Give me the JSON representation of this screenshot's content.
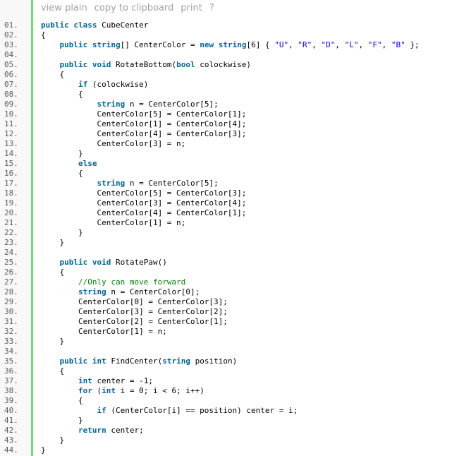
{
  "toolbar": {
    "view_plain": "view plain",
    "copy": "copy to clipboard",
    "print": "print",
    "help": "?"
  },
  "lines": [
    {
      "n": "01.",
      "t": [
        [
          "kw",
          "public class"
        ],
        [
          "txt",
          " CubeCenter"
        ]
      ]
    },
    {
      "n": "02.",
      "t": [
        [
          "txt",
          "{"
        ]
      ]
    },
    {
      "n": "03.",
      "t": [
        [
          "txt",
          "    "
        ],
        [
          "kw",
          "public"
        ],
        [
          "txt",
          " "
        ],
        [
          "ty",
          "string"
        ],
        [
          "txt",
          "[] CenterColor = "
        ],
        [
          "kw",
          "new"
        ],
        [
          "txt",
          " "
        ],
        [
          "ty",
          "string"
        ],
        [
          "txt",
          "[6] { "
        ],
        [
          "st",
          "\"U\""
        ],
        [
          "txt",
          ", "
        ],
        [
          "st",
          "\"R\""
        ],
        [
          "txt",
          ", "
        ],
        [
          "st",
          "\"D\""
        ],
        [
          "txt",
          ", "
        ],
        [
          "st",
          "\"L\""
        ],
        [
          "txt",
          ", "
        ],
        [
          "st",
          "\"F\""
        ],
        [
          "txt",
          ", "
        ],
        [
          "st",
          "\"B\""
        ],
        [
          "txt",
          " };"
        ]
      ]
    },
    {
      "n": "04.",
      "t": [
        [
          "txt",
          ""
        ]
      ]
    },
    {
      "n": "05.",
      "t": [
        [
          "txt",
          "    "
        ],
        [
          "kw",
          "public void"
        ],
        [
          "txt",
          " RotateBottom("
        ],
        [
          "ty",
          "bool"
        ],
        [
          "txt",
          " colockwise)"
        ]
      ]
    },
    {
      "n": "06.",
      "t": [
        [
          "txt",
          "    {"
        ]
      ]
    },
    {
      "n": "07.",
      "t": [
        [
          "txt",
          "        "
        ],
        [
          "kw",
          "if"
        ],
        [
          "txt",
          " (colockwise)"
        ]
      ]
    },
    {
      "n": "08.",
      "t": [
        [
          "txt",
          "        {"
        ]
      ]
    },
    {
      "n": "09.",
      "t": [
        [
          "txt",
          "            "
        ],
        [
          "ty",
          "string"
        ],
        [
          "txt",
          " n = CenterColor[5];"
        ]
      ]
    },
    {
      "n": "10.",
      "t": [
        [
          "txt",
          "            CenterColor[5] = CenterColor[1];"
        ]
      ]
    },
    {
      "n": "11.",
      "t": [
        [
          "txt",
          "            CenterColor[1] = CenterColor[4];"
        ]
      ]
    },
    {
      "n": "12.",
      "t": [
        [
          "txt",
          "            CenterColor[4] = CenterColor[3];"
        ]
      ]
    },
    {
      "n": "13.",
      "t": [
        [
          "txt",
          "            CenterColor[3] = n;"
        ]
      ]
    },
    {
      "n": "14.",
      "t": [
        [
          "txt",
          "        }"
        ]
      ]
    },
    {
      "n": "15.",
      "t": [
        [
          "txt",
          "        "
        ],
        [
          "kw",
          "else"
        ]
      ]
    },
    {
      "n": "16.",
      "t": [
        [
          "txt",
          "        {"
        ]
      ]
    },
    {
      "n": "17.",
      "t": [
        [
          "txt",
          "            "
        ],
        [
          "ty",
          "string"
        ],
        [
          "txt",
          " n = CenterColor[5];"
        ]
      ]
    },
    {
      "n": "18.",
      "t": [
        [
          "txt",
          "            CenterColor[5] = CenterColor[3];"
        ]
      ]
    },
    {
      "n": "19.",
      "t": [
        [
          "txt",
          "            CenterColor[3] = CenterColor[4];"
        ]
      ]
    },
    {
      "n": "20.",
      "t": [
        [
          "txt",
          "            CenterColor[4] = CenterColor[1];"
        ]
      ]
    },
    {
      "n": "21.",
      "t": [
        [
          "txt",
          "            CenterColor[1] = n;"
        ]
      ]
    },
    {
      "n": "22.",
      "t": [
        [
          "txt",
          "        }"
        ]
      ]
    },
    {
      "n": "23.",
      "t": [
        [
          "txt",
          "    }"
        ]
      ]
    },
    {
      "n": "24.",
      "t": [
        [
          "txt",
          ""
        ]
      ]
    },
    {
      "n": "25.",
      "t": [
        [
          "txt",
          "    "
        ],
        [
          "kw",
          "public void"
        ],
        [
          "txt",
          " RotatePaw()"
        ]
      ]
    },
    {
      "n": "26.",
      "t": [
        [
          "txt",
          "    {"
        ]
      ]
    },
    {
      "n": "27.",
      "t": [
        [
          "txt",
          "        "
        ],
        [
          "cm",
          "//Only can move forward"
        ]
      ]
    },
    {
      "n": "28.",
      "t": [
        [
          "txt",
          "        "
        ],
        [
          "ty",
          "string"
        ],
        [
          "txt",
          " n = CenterColor[0];"
        ]
      ]
    },
    {
      "n": "29.",
      "t": [
        [
          "txt",
          "        CenterColor[0] = CenterColor[3];"
        ]
      ]
    },
    {
      "n": "30.",
      "t": [
        [
          "txt",
          "        CenterColor[3] = CenterColor[2];"
        ]
      ]
    },
    {
      "n": "31.",
      "t": [
        [
          "txt",
          "        CenterColor[2] = CenterColor[1];"
        ]
      ]
    },
    {
      "n": "32.",
      "t": [
        [
          "txt",
          "        CenterColor[1] = n;"
        ]
      ]
    },
    {
      "n": "33.",
      "t": [
        [
          "txt",
          "    }"
        ]
      ]
    },
    {
      "n": "34.",
      "t": [
        [
          "txt",
          ""
        ]
      ]
    },
    {
      "n": "35.",
      "t": [
        [
          "txt",
          "    "
        ],
        [
          "kw",
          "public int"
        ],
        [
          "txt",
          " FindCenter("
        ],
        [
          "ty",
          "string"
        ],
        [
          "txt",
          " position)"
        ]
      ]
    },
    {
      "n": "36.",
      "t": [
        [
          "txt",
          "    {"
        ]
      ]
    },
    {
      "n": "37.",
      "t": [
        [
          "txt",
          "        "
        ],
        [
          "ty",
          "int"
        ],
        [
          "txt",
          " center = -1;"
        ]
      ]
    },
    {
      "n": "38.",
      "t": [
        [
          "txt",
          "        "
        ],
        [
          "kw",
          "for"
        ],
        [
          "txt",
          " ("
        ],
        [
          "ty",
          "int"
        ],
        [
          "txt",
          " i = 0; i < 6; i++)"
        ]
      ]
    },
    {
      "n": "39.",
      "t": [
        [
          "txt",
          "        {"
        ]
      ]
    },
    {
      "n": "40.",
      "t": [
        [
          "txt",
          "            "
        ],
        [
          "kw",
          "if"
        ],
        [
          "txt",
          " (CenterColor[i] == position) center = i;"
        ]
      ]
    },
    {
      "n": "41.",
      "t": [
        [
          "txt",
          "        }"
        ]
      ]
    },
    {
      "n": "42.",
      "t": [
        [
          "txt",
          "        "
        ],
        [
          "kw",
          "return"
        ],
        [
          "txt",
          " center;"
        ]
      ]
    },
    {
      "n": "43.",
      "t": [
        [
          "txt",
          "    }"
        ]
      ]
    },
    {
      "n": "44.",
      "t": [
        [
          "txt",
          "}"
        ]
      ]
    }
  ]
}
